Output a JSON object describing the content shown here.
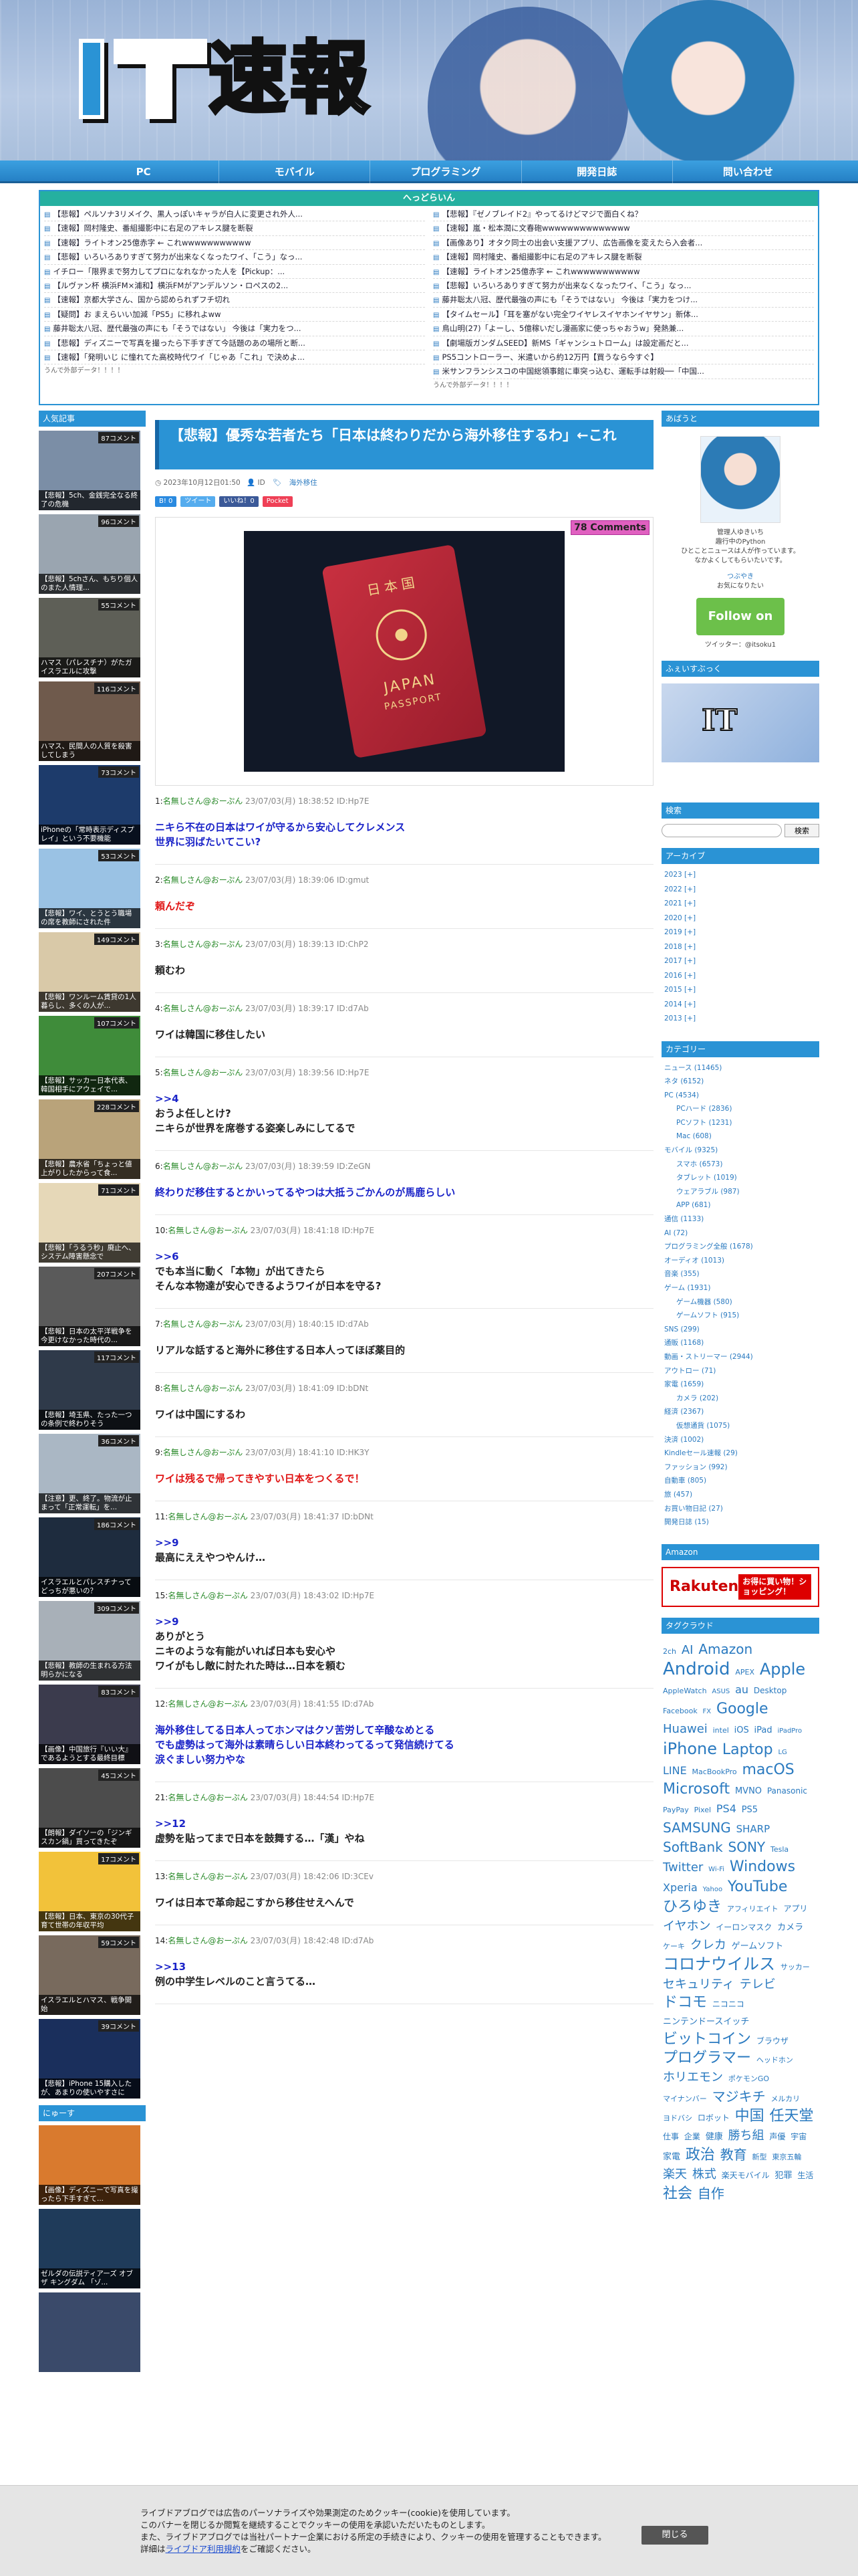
{
  "site": {
    "logo_text": "速報",
    "logo_prefix": "IT"
  },
  "nav": [
    "PC",
    "モバイル",
    "プログラミング",
    "開発日誌",
    "問い合わせ"
  ],
  "ticker": {
    "head": "へっどらいん",
    "left": [
      "【悲報】ペルソナ3リメイク、黒人っぽいキャラが白人に変更され外人...",
      "【速報】岡村隆史、番組撮影中に右足のアキレス腱を断裂",
      "【速報】ライトオン25億赤字 ← これwwwwwwwwwww",
      "【悲報】いろいろありすぎて努力が出来なくなったワイ、「こう」なっ...",
      "イチロー「限界まで努力してプロになれなかった人を【Pickup：...",
      "【ルヴァン杯 横浜FM×浦和】横浜FMがアンデルソン・ロペスの2...",
      "【速報】京都大学さん、国から認められずフチ切れ",
      "【疑問】お まえらいい加減「PS5」に移れよww",
      "藤井聡太八冠、歴代最強の声にも「そうではない」 今後は「実力をつ...",
      "【悲報】ディズニーで写真を撮ったら下手すぎて今話題のあの場所と断...",
      "【速報】「発明いじ に憧れてた高校時代ワイ「じゃあ「これ」で決めよ..."
    ],
    "right": [
      "【悲報】『ゼノブレイド2』やってるけどマジで面白くね？",
      "【速報】嵐・松本潤に文春砲wwwwwwwwwwwwww",
      "【画像あり】オタク同士の出会い支援アプリ、広告画像を変えたら入会者...",
      "【速報】岡村隆史、番組撮影中に右足のアキレス腱を断裂",
      "【速報】ライトオン25億赤字 ← これwwwwwwwwwww",
      "【悲報】いろいろありすぎて努力が出来なくなったワイ、「こう」なっ...",
      "藤井聡太八冠、歴代最強の声にも「そうではない」 今後は「実力をつけ...",
      "【タイムセール】「耳を塞がない完全ワイヤレスイヤホンイヤサン」新体...",
      "鳥山明(27)「よーし、5億稼いだし漫画家に使っちゃおうw」発熱兼...",
      "【劇場版ガンダムSEED】新MS「ギャンシュトローム」は設定画だと...",
      "PS5コントローラー、米遣いから約12万円【買うなら今すぐ】",
      "米サンフランシスコの中国総領事館に車突っ込む、運転手は射殺──「中国..."
    ],
    "foot_left": "うんで外部データ！！！！",
    "foot_right": "うんで外部データ！！！！"
  },
  "left_sidebar": {
    "head": "人気記事",
    "items": [
      {
        "count": "87コメント",
        "caption": "【悲報】5ch、金銭完全なる終了の危機",
        "color": "#7b8ea6"
      },
      {
        "count": "96コメント",
        "caption": "【悲報】5chさん、もちり個人のまた人情理...",
        "color": "#9aa5b0"
      },
      {
        "count": "55コメント",
        "caption": "ハマス（パレスチナ）がたガイスラエルに攻撃",
        "color": "#5e5f57"
      },
      {
        "count": "116コメント",
        "caption": "ハマス、民間人の人質を殺害してしまう",
        "color": "#6f5a4c"
      },
      {
        "count": "73コメント",
        "caption": "iPhoneの「常時表示ディスプレイ」という不要機能",
        "color": "#1d3b6b"
      },
      {
        "count": "53コメント",
        "caption": "【悲報】ワイ、とうとう職場の席を教師にされた件",
        "color": "#9ac2e4"
      },
      {
        "count": "149コメント",
        "caption": "【悲報】ワンルーム賃貸の1人暮らし、多くの人が...",
        "color": "#d9c9a8"
      },
      {
        "count": "107コメント",
        "caption": "【悲報】サッカー日本代表、韓国相手にアウェイで...",
        "color": "#3f8c3a"
      },
      {
        "count": "228コメント",
        "caption": "【悲報】農水省「ちょっと値上がりしたからって食...",
        "color": "#b9a37a"
      },
      {
        "count": "71コメント",
        "caption": "【悲報】「うるう秒」廃止へ、システム障害懸念で",
        "color": "#e6d8b8"
      },
      {
        "count": "207コメント",
        "caption": "【悲報】日本の太平洋戦争を今更けなかった時代の...",
        "color": "#5a5a5a"
      },
      {
        "count": "117コメント",
        "caption": "【悲報】埼玉県、たった一つの条例で終わりそう",
        "color": "#2f3a4a"
      },
      {
        "count": "36コメント",
        "caption": "【注意】更、終了。物流が止まって「正常運転」を...",
        "color": "#aab7c4"
      },
      {
        "count": "186コメント",
        "caption": "イスラエルとパレスチナってどっちが悪いの？",
        "color": "#1e2c3e"
      },
      {
        "count": "309コメント",
        "caption": "【悲報】教師の生まれる方法明らかになる",
        "color": "#a8b0b8"
      },
      {
        "count": "83コメント",
        "caption": "【画像】中国旅行『いい大』であるようとする最終目標",
        "color": "#3b3b4d"
      },
      {
        "count": "45コメント",
        "caption": "【朗報】ダイソーの「ジンギスカン鍋」買ってきたぞ",
        "color": "#4c4c4c"
      },
      {
        "count": "17コメント",
        "caption": "【悲報】日本、東京の30代子育て世帯の年収平均",
        "color": "#f2c23a"
      },
      {
        "count": "59コメント",
        "caption": "イスラエルとハマス、戦争開始",
        "color": "#786a5d"
      },
      {
        "count": "39コメント",
        "caption": "【悲報】iPhone 15購入したが、あまりの使いやすさに",
        "color": "#1a2f5c"
      }
    ],
    "head2": "にゅーす",
    "news": [
      {
        "caption": "【画像】ディズニーで写真を撮ったら下手すぎて...",
        "color": "#d97a2e"
      },
      {
        "caption": "ゼルダの伝説ティアーズ オブ ザ キングダム 「ゾ...",
        "color": "#1f3b5a"
      },
      {
        "caption": "",
        "color": "#3a4a6a"
      }
    ]
  },
  "article": {
    "title": "【悲報】優秀な若者たち「日本は終わりだから海外移住するわ」←これ",
    "date": "2023年10月12日01:50",
    "author": "ID",
    "category": "海外移住",
    "comments": "78 Comments",
    "share": [
      {
        "label": "B! 0",
        "color": "#2a8ae0"
      },
      {
        "label": "ツイート",
        "color": "#55acee"
      },
      {
        "label": "いいね！0",
        "color": "#3b5998"
      },
      {
        "label": "Pocket",
        "color": "#ef4056"
      }
    ],
    "hero_text": {
      "country": "日本国",
      "title": "JAPAN",
      "sub": "PASSPORT"
    },
    "comments_list": [
      {
        "n": "1:",
        "name": "名無しさん@おーぷん",
        "meta": "23/07/03(月) 18:38:52 ID:Hp7E",
        "body": "ニキら不在の日本はワイが守るから安心してクレメンス\n世界に羽ばたいてこい?",
        "cls": "blue"
      },
      {
        "n": "2:",
        "name": "名無しさん@おーぷん",
        "meta": "23/07/03(月) 18:39:06 ID:gmut",
        "body": "頼んだぞ",
        "cls": "red"
      },
      {
        "n": "3:",
        "name": "名無しさん@おーぷん",
        "meta": "23/07/03(月) 18:39:13 ID:ChP2",
        "body": "頼むわ",
        "cls": ""
      },
      {
        "n": "4:",
        "name": "名無しさん@おーぷん",
        "meta": "23/07/03(月) 18:39:17 ID:d7Ab",
        "body": "ワイは韓国に移住したい",
        "cls": ""
      },
      {
        "n": "5:",
        "name": "名無しさん@おーぷん",
        "meta": "23/07/03(月) 18:39:56 ID:Hp7E",
        "anchor": ">>4",
        "body": "おうよ任しとけ?\nニキらが世界を席巻する姿楽しみにしてるで",
        "cls": ""
      },
      {
        "n": "6:",
        "name": "名無しさん@おーぷん",
        "meta": "23/07/03(月) 18:39:59 ID:ZeGN",
        "body": "終わりだ移住するとかいってるやつは大抵うごかんのが馬鹿らしい",
        "cls": "blue"
      },
      {
        "n": "10:",
        "name": "名無しさん@おーぷん",
        "meta": "23/07/03(月) 18:41:18 ID:Hp7E",
        "anchor": ">>6",
        "body": "でも本当に動く「本物」が出てきたら\nそんな本物達が安心できるようワイが日本を守る?",
        "cls": ""
      },
      {
        "n": "7:",
        "name": "名無しさん@おーぷん",
        "meta": "23/07/03(月) 18:40:15 ID:d7Ab",
        "body": "リアルな話すると海外に移住する日本人ってほぼ薬目的",
        "cls": ""
      },
      {
        "n": "8:",
        "name": "名無しさん@おーぷん",
        "meta": "23/07/03(月) 18:41:09 ID:bDNt",
        "body": "ワイは中国にするわ",
        "cls": ""
      },
      {
        "n": "9:",
        "name": "名無しさん@おーぷん",
        "meta": "23/07/03(月) 18:41:10 ID:HK3Y",
        "body": "ワイは残るで帰ってきやすい日本をつくるで！",
        "cls": "red"
      },
      {
        "n": "11:",
        "name": "名無しさん@おーぷん",
        "meta": "23/07/03(月) 18:41:37 ID:bDNt",
        "anchor": ">>9",
        "body": "最高にええやつやんけ…",
        "cls": ""
      },
      {
        "n": "15:",
        "name": "名無しさん@おーぷん",
        "meta": "23/07/03(月) 18:43:02 ID:Hp7E",
        "anchor": ">>9",
        "body": "ありがとう\nニキのような有能がいれば日本も安心や\nワイがもし敵に討たれた時は…日本を頼む",
        "cls": ""
      },
      {
        "n": "12:",
        "name": "名無しさん@おーぷん",
        "meta": "23/07/03(月) 18:41:55 ID:d7Ab",
        "body": "海外移住してる日本人ってホンマはクソ苦労して辛酸なめとる\nでも虚勢はって海外は素晴らしい日本終わってるって発信続けてる\n涙ぐましい努力やな",
        "cls": "blue"
      },
      {
        "n": "21:",
        "name": "名無しさん@おーぷん",
        "meta": "23/07/03(月) 18:44:54 ID:Hp7E",
        "anchor": ">>12",
        "body": "虚勢を貼ってまで日本を鼓舞する…「漢」やね",
        "cls": ""
      },
      {
        "n": "13:",
        "name": "名無しさん@おーぷん",
        "meta": "23/07/03(月) 18:42:06 ID:3CEv",
        "body": "ワイは日本で革命起こすから移住せえへんで",
        "cls": ""
      },
      {
        "n": "14:",
        "name": "名無しさん@おーぷん",
        "meta": "23/07/03(月) 18:42:48 ID:d7Ab",
        "anchor": ">>13",
        "body": "例の中学生レベルのこと言うてる…",
        "cls": ""
      }
    ]
  },
  "right_sidebar": {
    "about_head": "あばうと",
    "about_lines": [
      "管理人ゆきいち",
      "趣行中のPython",
      "ひとことニュースは人が作っています。",
      "なかよくしてもらいたいです。"
    ],
    "about_link": "つぶやき",
    "about_sub": "お気になりたい",
    "follow": "Follow on feedly",
    "twitter": "ツイッター：@itsoku1",
    "fb_head": "ふぇいすぶっく",
    "search_head": "検索",
    "search_button": "検索",
    "archive_head": "アーカイブ",
    "archive": [
      "2023 [+]",
      "2022 [+]",
      "2021 [+]",
      "2020 [+]",
      "2019 [+]",
      "2018 [+]",
      "2017 [+]",
      "2016 [+]",
      "2015 [+]",
      "2014 [+]",
      "2013 [+]"
    ],
    "category_head": "カテゴリー",
    "categories": [
      {
        "t": "ニュース (11465)",
        "s": false
      },
      {
        "t": "ネタ (6152)",
        "s": false
      },
      {
        "t": "PC (4534)",
        "s": false
      },
      {
        "t": "PCハード (2836)",
        "s": true
      },
      {
        "t": "PCソフト (1231)",
        "s": true
      },
      {
        "t": "Mac (608)",
        "s": true
      },
      {
        "t": "モバイル (9325)",
        "s": false
      },
      {
        "t": "スマホ (6573)",
        "s": true
      },
      {
        "t": "タブレット (1019)",
        "s": true
      },
      {
        "t": "ウェアラブル (987)",
        "s": true
      },
      {
        "t": "APP (681)",
        "s": true
      },
      {
        "t": "通信 (1133)",
        "s": false
      },
      {
        "t": "AI (72)",
        "s": false
      },
      {
        "t": "プログラミング全般 (1678)",
        "s": false
      },
      {
        "t": "オーディオ (1013)",
        "s": false
      },
      {
        "t": "音楽 (355)",
        "s": false
      },
      {
        "t": "ゲーム (1931)",
        "s": false
      },
      {
        "t": "ゲーム機器 (580)",
        "s": true
      },
      {
        "t": "ゲームソフト (915)",
        "s": true
      },
      {
        "t": "SNS (299)",
        "s": false
      },
      {
        "t": "通販 (1168)",
        "s": false
      },
      {
        "t": "動画・ストリーマー (2944)",
        "s": false
      },
      {
        "t": "アウトロー (71)",
        "s": false
      },
      {
        "t": "家電 (1659)",
        "s": false
      },
      {
        "t": "カメラ (202)",
        "s": true
      },
      {
        "t": "経済 (2367)",
        "s": false
      },
      {
        "t": "仮想通貨 (1075)",
        "s": true
      },
      {
        "t": "決済 (1002)",
        "s": false
      },
      {
        "t": "Kindleセール速報 (29)",
        "s": false
      },
      {
        "t": "ファッション (992)",
        "s": false
      },
      {
        "t": "自動車 (805)",
        "s": false
      },
      {
        "t": "旅 (457)",
        "s": false
      },
      {
        "t": "お買い物日記 (27)",
        "s": false
      },
      {
        "t": "開発日誌 (15)",
        "s": false
      }
    ],
    "amazon_head": "Amazon",
    "rakuten": {
      "logo": "Rakuten",
      "btn": "お得に買い物！ショッピング！"
    },
    "tag_head": "タグクラウド",
    "tags": [
      {
        "t": "2ch",
        "s": 11
      },
      {
        "t": "AI",
        "s": 18
      },
      {
        "t": "Amazon",
        "s": 20
      },
      {
        "t": "Android",
        "s": 26
      },
      {
        "t": "APEX",
        "s": 11
      },
      {
        "t": "Apple",
        "s": 24
      },
      {
        "t": "AppleWatch",
        "s": 11
      },
      {
        "t": "ASUS",
        "s": 10
      },
      {
        "t": "au",
        "s": 16
      },
      {
        "t": "Desktop",
        "s": 12
      },
      {
        "t": "Facebook",
        "s": 11
      },
      {
        "t": "FX",
        "s": 10
      },
      {
        "t": "Google",
        "s": 22
      },
      {
        "t": "Huawei",
        "s": 18
      },
      {
        "t": "intel",
        "s": 11
      },
      {
        "t": "iOS",
        "s": 13
      },
      {
        "t": "iPad",
        "s": 13
      },
      {
        "t": "iPadPro",
        "s": 10
      },
      {
        "t": "iPhone",
        "s": 24
      },
      {
        "t": "Laptop",
        "s": 22
      },
      {
        "t": "LG",
        "s": 10
      },
      {
        "t": "LINE",
        "s": 16
      },
      {
        "t": "MacBookPro",
        "s": 11
      },
      {
        "t": "macOS",
        "s": 22
      },
      {
        "t": "Microsoft",
        "s": 22
      },
      {
        "t": "MVNO",
        "s": 13
      },
      {
        "t": "Panasonic",
        "s": 12
      },
      {
        "t": "PayPay",
        "s": 11
      },
      {
        "t": "Pixel",
        "s": 11
      },
      {
        "t": "PS4",
        "s": 16
      },
      {
        "t": "PS5",
        "s": 13
      },
      {
        "t": "SAMSUNG",
        "s": 20
      },
      {
        "t": "SHARP",
        "s": 15
      },
      {
        "t": "SoftBank",
        "s": 20
      },
      {
        "t": "SONY",
        "s": 20
      },
      {
        "t": "Tesla",
        "s": 11
      },
      {
        "t": "Twitter",
        "s": 18
      },
      {
        "t": "Wi-Fi",
        "s": 10
      },
      {
        "t": "Windows",
        "s": 22
      },
      {
        "t": "Xperia",
        "s": 16
      },
      {
        "t": "Yahoo",
        "s": 10
      },
      {
        "t": "YouTube",
        "s": 22
      },
      {
        "t": "ひろゆき",
        "s": 22
      },
      {
        "t": "アフィリエイト",
        "s": 11
      },
      {
        "t": "アプリ",
        "s": 12
      },
      {
        "t": "イヤホン",
        "s": 18
      },
      {
        "t": "イーロンマスク",
        "s": 12
      },
      {
        "t": "カメラ",
        "s": 13
      },
      {
        "t": "ケーキ",
        "s": 11
      },
      {
        "t": "クレカ",
        "s": 18
      },
      {
        "t": "ゲームソフト",
        "s": 13
      },
      {
        "t": "コロナウイルス",
        "s": 24
      },
      {
        "t": "サッカー",
        "s": 11
      },
      {
        "t": "セキュリティ",
        "s": 18
      },
      {
        "t": "テレビ",
        "s": 18
      },
      {
        "t": "ドコモ",
        "s": 22
      },
      {
        "t": "ニコニコ",
        "s": 12
      },
      {
        "t": "ニンテンドースイッチ",
        "s": 13
      },
      {
        "t": "ビットコイン",
        "s": 22
      },
      {
        "t": "ブラウザ",
        "s": 12
      },
      {
        "t": "プログラマー",
        "s": 22
      },
      {
        "t": "ヘッドホン",
        "s": 11
      },
      {
        "t": "ホリエモン",
        "s": 18
      },
      {
        "t": "ポケモンGO",
        "s": 11
      },
      {
        "t": "マイナンバー",
        "s": 11
      },
      {
        "t": "マジキチ",
        "s": 20
      },
      {
        "t": "メルカリ",
        "s": 11
      },
      {
        "t": "ヨドバシ",
        "s": 11
      },
      {
        "t": "ロボット",
        "s": 12
      },
      {
        "t": "中国",
        "s": 22
      },
      {
        "t": "任天堂",
        "s": 22
      },
      {
        "t": "仕事",
        "s": 12
      },
      {
        "t": "企業",
        "s": 12
      },
      {
        "t": "健康",
        "s": 13
      },
      {
        "t": "勝ち組",
        "s": 18
      },
      {
        "t": "声優",
        "s": 12
      },
      {
        "t": "宇宙",
        "s": 12
      },
      {
        "t": "家電",
        "s": 13
      },
      {
        "t": "政治",
        "s": 22
      },
      {
        "t": "教育",
        "s": 20
      },
      {
        "t": "新型",
        "s": 11
      },
      {
        "t": "東京五輪",
        "s": 11
      },
      {
        "t": "楽天",
        "s": 18
      },
      {
        "t": "株式",
        "s": 18
      },
      {
        "t": "楽天モバイル",
        "s": 12
      },
      {
        "t": "犯罪",
        "s": 13
      },
      {
        "t": "生活",
        "s": 12
      },
      {
        "t": "社会",
        "s": 22
      },
      {
        "t": "自作",
        "s": 20
      }
    ]
  },
  "cookie": {
    "lines": [
      "ライブドアブログでは広告のパーソナライズや効果測定のためクッキー(cookie)を使用しています。",
      "このバナーを閉じるか閲覧を継続することでクッキーの使用を承認いただいたものとします。",
      "また、ライブドアブログでは当社パートナー企業における所定の手続きにより、クッキーの使用を管理することもできます。"
    ],
    "tail_pre": "詳細は",
    "link": "ライブドア利用規約",
    "tail_post": "をご確認ください。",
    "close": "閉じる"
  }
}
